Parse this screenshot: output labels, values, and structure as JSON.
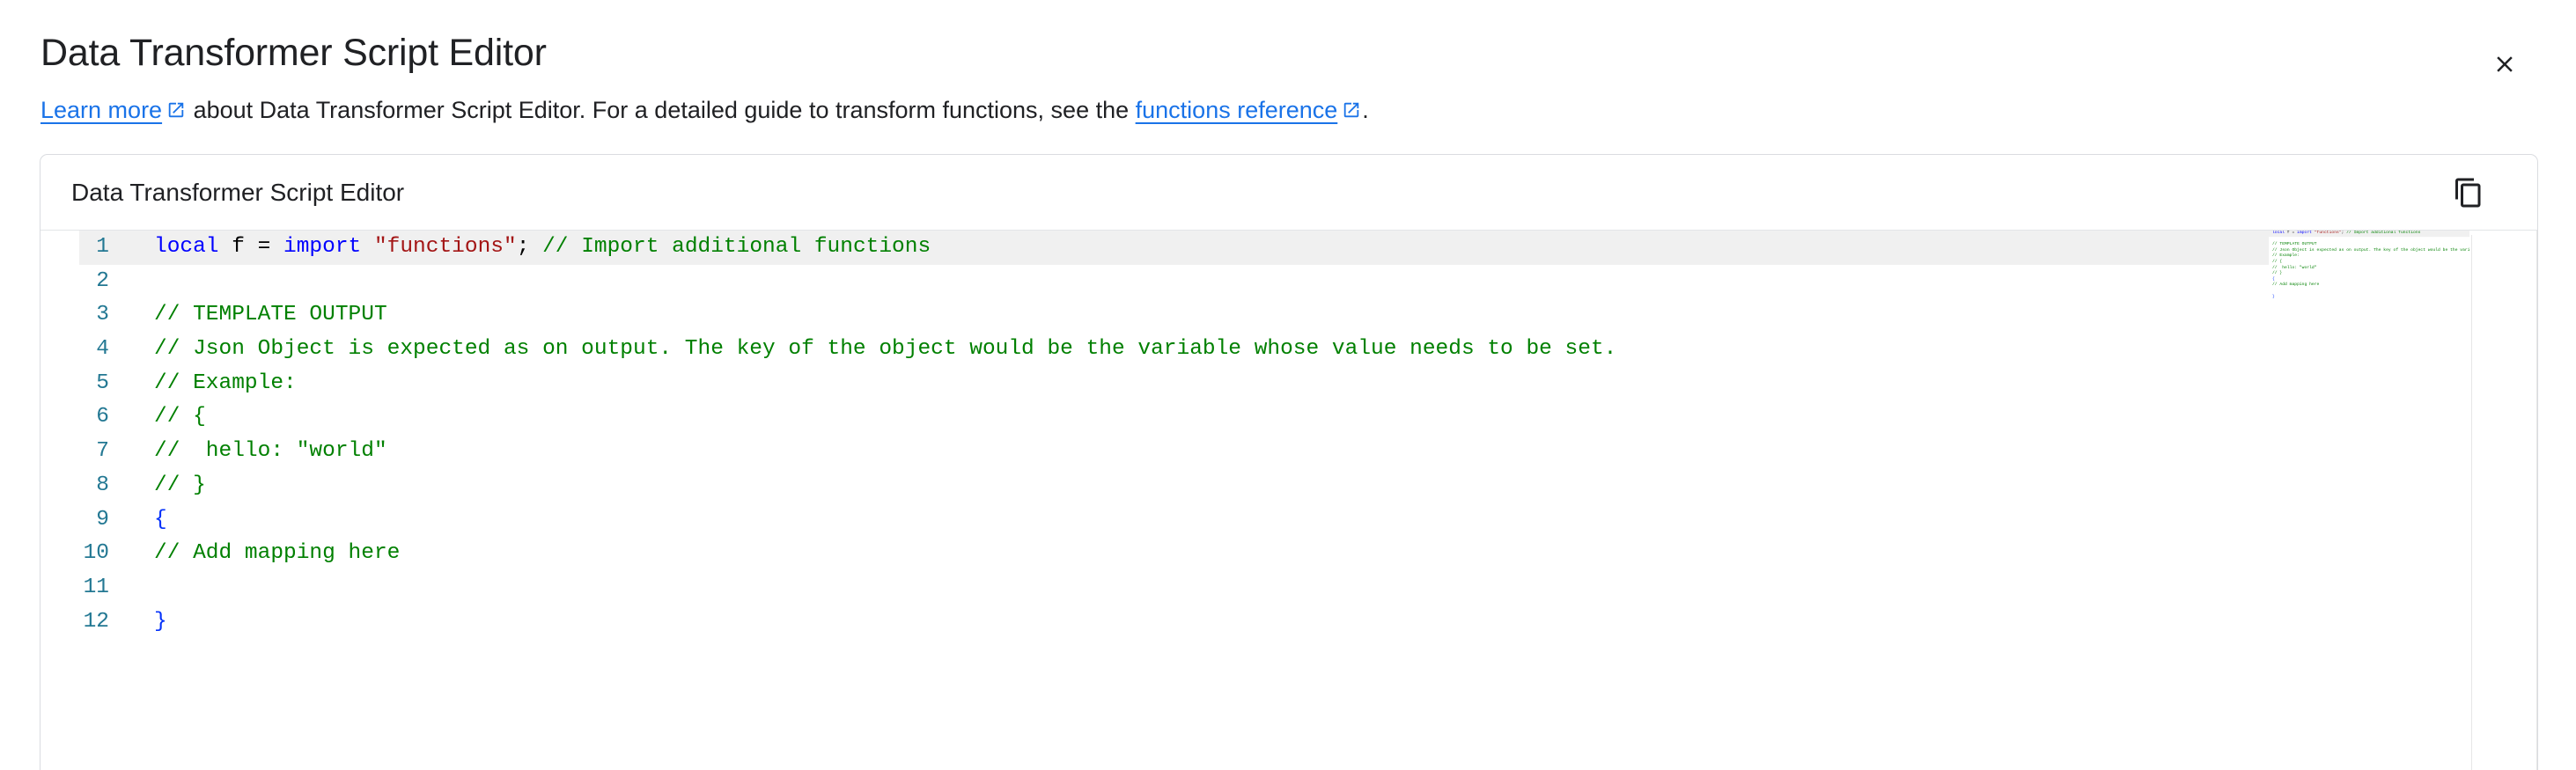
{
  "dialog": {
    "title": "Data Transformer Script Editor",
    "close_icon": "close-icon",
    "close_label": "Close"
  },
  "description": {
    "link_text": "Learn more",
    "link_icon": "external-link-icon",
    "middle_text": " about Data Transformer Script Editor. For a detailed guide to transform functions, see the ",
    "reference_link_text": "functions reference",
    "reference_icon": "external-link-icon",
    "end_text": "."
  },
  "card": {
    "title": "Data Transformer Script Editor",
    "copy_icon": "copy-icon",
    "copy_label": "Copy"
  },
  "editor": {
    "language": "jsonnet",
    "active_line": 1,
    "total_lines": 12,
    "line_numbers": [
      "1",
      "2",
      "3",
      "4",
      "5",
      "6",
      "7",
      "8",
      "9",
      "10",
      "11",
      "12"
    ],
    "lines": [
      {
        "number": "1",
        "active": true,
        "plain": "local f = import \"functions\"; // Import additional functions",
        "tokens": [
          {
            "text": "local",
            "type": "kw"
          },
          {
            "text": " f = ",
            "type": "plain"
          },
          {
            "text": "import",
            "type": "kw"
          },
          {
            "text": " ",
            "type": "plain"
          },
          {
            "text": "\"functions\"",
            "type": "str"
          },
          {
            "text": ";",
            "type": "plain"
          },
          {
            "text": " // Import additional functions",
            "type": "comment"
          }
        ]
      },
      {
        "number": "2",
        "active": false,
        "plain": "",
        "tokens": []
      },
      {
        "number": "3",
        "active": false,
        "plain": "// TEMPLATE OUTPUT",
        "tokens": [
          {
            "text": "// TEMPLATE OUTPUT",
            "type": "comment"
          }
        ]
      },
      {
        "number": "4",
        "active": false,
        "plain": "// Json Object is expected as on output. The key of the object would be the variable whose value needs to be set.",
        "tokens": [
          {
            "text": "// Json Object is expected as on output. The key of the object would be the variable whose value needs to be set.",
            "type": "comment"
          }
        ]
      },
      {
        "number": "5",
        "active": false,
        "plain": "// Example:",
        "tokens": [
          {
            "text": "// Example:",
            "type": "comment"
          }
        ]
      },
      {
        "number": "6",
        "active": false,
        "plain": "// {",
        "tokens": [
          {
            "text": "// {",
            "type": "comment"
          }
        ]
      },
      {
        "number": "7",
        "active": false,
        "plain": "//  hello: \"world\"",
        "tokens": [
          {
            "text": "//  hello: \"world\"",
            "type": "comment"
          }
        ]
      },
      {
        "number": "8",
        "active": false,
        "plain": "// }",
        "tokens": [
          {
            "text": "// }",
            "type": "comment"
          }
        ]
      },
      {
        "number": "9",
        "active": false,
        "plain": "{",
        "tokens": [
          {
            "text": "{",
            "type": "brace"
          }
        ]
      },
      {
        "number": "10",
        "active": false,
        "plain": "// Add mapping here",
        "tokens": [
          {
            "text": "// Add mapping here",
            "type": "comment"
          }
        ]
      },
      {
        "number": "11",
        "active": false,
        "plain": "",
        "tokens": []
      },
      {
        "number": "12",
        "active": false,
        "plain": "}",
        "tokens": [
          {
            "text": "}",
            "type": "brace"
          }
        ]
      }
    ]
  },
  "colors": {
    "link": "#1a73e8",
    "keyword": "#0000ff",
    "string": "#a31515",
    "comment": "#008000",
    "brace": "#0431fa",
    "line_number": "#237893",
    "active_line_bg": "#f0f0f0",
    "card_border": "#dadce0",
    "text": "#202124"
  }
}
